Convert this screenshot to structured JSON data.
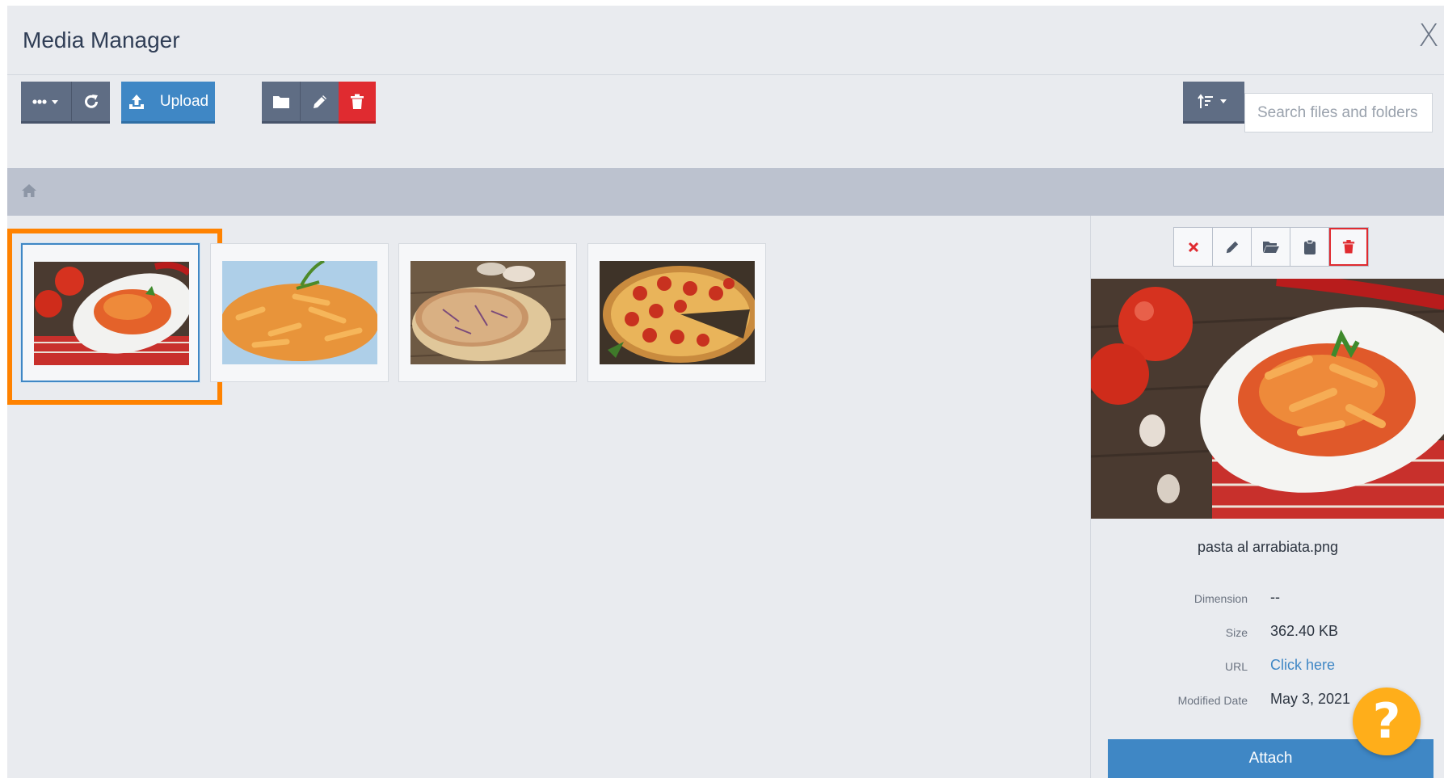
{
  "header": {
    "title": "Media Manager",
    "close_label": "X"
  },
  "toolbar": {
    "upload_label": "Upload",
    "search_placeholder": "Search files and folders",
    "buttons": [
      "more-options",
      "refresh",
      "upload",
      "new-folder",
      "rename",
      "delete",
      "sort"
    ]
  },
  "breadcrumb": {
    "icon": "home-icon"
  },
  "files": [
    {
      "name": "pasta al arrabiata.png",
      "kind": "pasta-tomato",
      "selected": true
    },
    {
      "name": "penne",
      "kind": "penne"
    },
    {
      "name": "pizza",
      "kind": "pizza-plain"
    },
    {
      "name": "pepperoni pizza",
      "kind": "pizza-pepperoni"
    }
  ],
  "details": {
    "file_name": "pasta al arrabiata.png",
    "dimension_label": "Dimension",
    "dimension_value": "--",
    "size_label": "Size",
    "size_value": "362.40 KB",
    "url_label": "URL",
    "url_value": "Click here",
    "modified_label": "Modified Date",
    "modified_value": "May 3, 2021",
    "attach_label": "Attach",
    "tools": [
      "close-icon",
      "pencil-icon",
      "folder-open-icon",
      "clipboard-icon",
      "trash-icon"
    ]
  },
  "help": {
    "label": "?"
  },
  "colors": {
    "accent_blue": "#3f87c5",
    "danger_red": "#e02b30",
    "dark_button": "#5f6d84",
    "highlight_orange": "#ff8200",
    "help_yellow": "#ffae1a"
  }
}
